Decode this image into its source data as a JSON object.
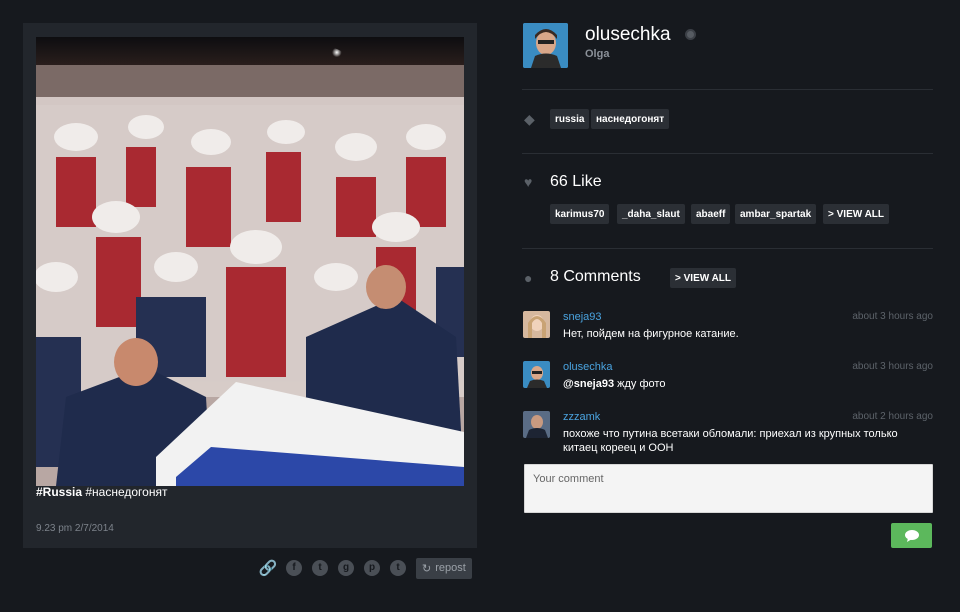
{
  "post": {
    "caption_tag": "#Russia",
    "caption_rest": " #наснедогонят",
    "timestamp": "9.23 pm 2/7/2014"
  },
  "share": {
    "icons": [
      "link-icon",
      "facebook-icon",
      "twitter-icon",
      "googleplus-icon",
      "pinterest-icon",
      "tumblr-icon"
    ],
    "repost_label": "repost"
  },
  "profile": {
    "username": "olusechka",
    "fullname": "Olga"
  },
  "tags": [
    "russia",
    "наснедогонят"
  ],
  "likes": {
    "count_label": "66 Like",
    "users": [
      "karimus70",
      "_daha_slaut",
      "abaeff",
      "ambar_spartak"
    ],
    "view_all": "> VIEW ALL"
  },
  "comments": {
    "count_label": "8 Comments",
    "view_all": "> VIEW ALL",
    "items": [
      {
        "user": "sneja93",
        "time": "about 3 hours ago",
        "text": "Нет, пойдем на фигурное катание."
      },
      {
        "user": "olusechka",
        "time": "about 3 hours ago",
        "mention": "@sneja93",
        "text": " жду фото"
      },
      {
        "user": "zzzamk",
        "time": "about 2 hours ago",
        "text": "похоже что путина всетаки обломали: приехал из крупных только китаец кореец и ООН"
      }
    ]
  },
  "comment_form": {
    "placeholder": "Your comment"
  },
  "colors": {
    "background": "#16191e",
    "card": "#22262c",
    "chip": "#2b2f35",
    "link": "#4aa3df",
    "send": "#5cb85c"
  }
}
